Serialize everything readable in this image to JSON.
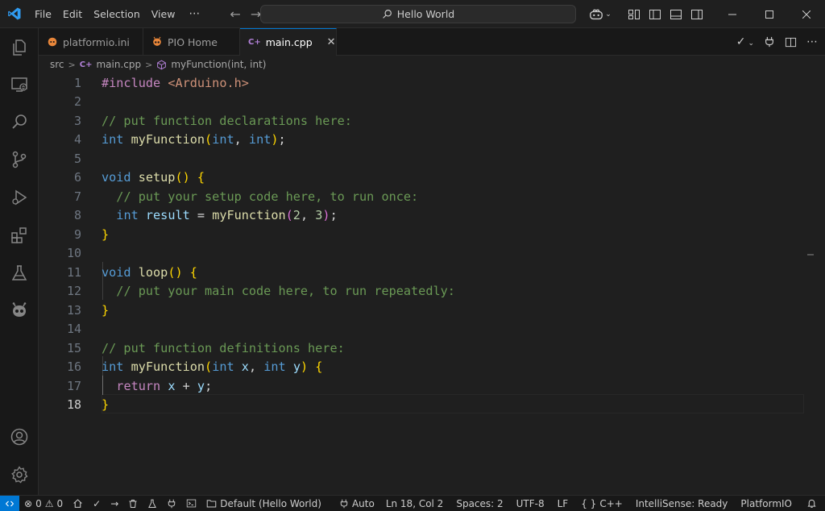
{
  "menu": {
    "items": [
      "File",
      "Edit",
      "Selection",
      "View"
    ],
    "more": "⋯"
  },
  "search": {
    "text": "Hello World"
  },
  "tabs": [
    {
      "label": "platformio.ini"
    },
    {
      "label": "PIO Home"
    },
    {
      "label": "main.cpp",
      "badge": "C+"
    }
  ],
  "breadcrumb": {
    "folder": "src",
    "file": "main.cpp",
    "file_badge": "C+",
    "symbol": "myFunction(int, int)"
  },
  "editor": {
    "current_line": 18,
    "line_numbers": [
      "1",
      "2",
      "3",
      "4",
      "5",
      "6",
      "7",
      "8",
      "9",
      "10",
      "11",
      "12",
      "13",
      "14",
      "15",
      "16",
      "17",
      "18"
    ],
    "code": {
      "l1_directive": "#include",
      "l1_header": "<Arduino.h>",
      "l3_comment": "// put function declarations here:",
      "l4_type1": "int",
      "l4_name": "myFunction",
      "l4_type2": "int",
      "l4_type3": "int",
      "l6_type": "void",
      "l6_name": "setup",
      "l7_comment": "// put your setup code here, to run once:",
      "l8_type": "int",
      "l8_var": "result",
      "l8_call": "myFunction",
      "l8_arg1": "2",
      "l8_arg2": "3",
      "l11_type": "void",
      "l11_name": "loop",
      "l12_comment": "// put your main code here, to run repeatedly:",
      "l15_comment": "// put function definitions here:",
      "l16_type1": "int",
      "l16_name": "myFunction",
      "l16_type2": "int",
      "l16_p1": "x",
      "l16_type3": "int",
      "l16_p2": "y",
      "l17_kw": "return",
      "l17_a": "x",
      "l17_b": "y"
    }
  },
  "status": {
    "errors": "0",
    "warnings": "0",
    "environment": "Default (Hello World)",
    "port": "Auto",
    "position": "Ln 18, Col 2",
    "spaces": "Spaces: 2",
    "encoding": "UTF-8",
    "eol": "LF",
    "language": "C++",
    "language_prefix": "{ }",
    "intellisense": "IntelliSense: Ready",
    "platform": "PlatformIO"
  },
  "colors": {
    "accent": "#0078d4",
    "keyword": "#569cd6",
    "comment": "#6a9955",
    "function": "#dcdcaa",
    "string": "#ce9178"
  },
  "icons": [
    "vscode-logo-icon",
    "explorer-icon",
    "remote-explorer-icon",
    "search-icon",
    "source-control-icon",
    "run-debug-icon",
    "extensions-icon",
    "testing-icon",
    "platformio-icon",
    "account-icon",
    "manage-gear-icon",
    "bell-icon"
  ]
}
